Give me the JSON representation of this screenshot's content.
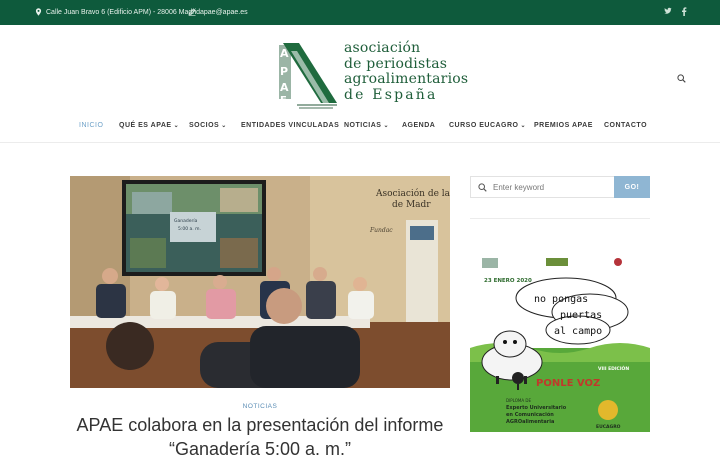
{
  "topbar": {
    "address": "Calle Juan Bravo 6 (Edificio APM) - 28006 Madrid",
    "email": "apae@apae.es",
    "social": [
      "twitter-icon",
      "facebook-icon"
    ]
  },
  "logo": {
    "line1": "asociación",
    "line2": "de periodistas",
    "line3": "agroalimentarios",
    "line4": "de España"
  },
  "nav": {
    "items": [
      {
        "label": "INICIO",
        "active": true
      },
      {
        "label": "QUÉ ES APAE"
      },
      {
        "label": "SOCIOS"
      },
      {
        "label": "ENTIDADES VINCULADAS"
      },
      {
        "label": "NOTICIAS"
      },
      {
        "label": "AGENDA"
      },
      {
        "label": "CURSO EUCAGRO"
      },
      {
        "label": "PREMIOS APAE"
      },
      {
        "label": "CONTACTO"
      }
    ]
  },
  "hero": {
    "wall_text": "Asociación de la Prensa de Madrid",
    "screen_text": "Ganadería 5:00 a.m."
  },
  "post": {
    "category": "NOTICIAS",
    "title": "APAE colabora en la presentación del informe “Ganadería 5:00 a. m.”"
  },
  "sidebar": {
    "search_placeholder": "Enter keyword",
    "go_label": "GO!",
    "banner": {
      "date": "23 ENERO 2020",
      "slogan_line1": "no pongas",
      "slogan_line2": "puertas",
      "slogan_line3": "al campo",
      "edition": "VIII EDICIÓN",
      "cta": "PONLE VOZ",
      "diploma_line1": "DIPLOMA DE",
      "diploma_line2": "Experto Universitario",
      "diploma_line3": "en Comunicación",
      "diploma_line4": "AGROalimentaria",
      "brand": "EUCAGRO"
    }
  },
  "colors": {
    "topbar": "#0e5a3c",
    "brand_green": "#1f5e3a",
    "accent_blue": "#6fa2c9",
    "button_blue": "#8fb6d3"
  }
}
